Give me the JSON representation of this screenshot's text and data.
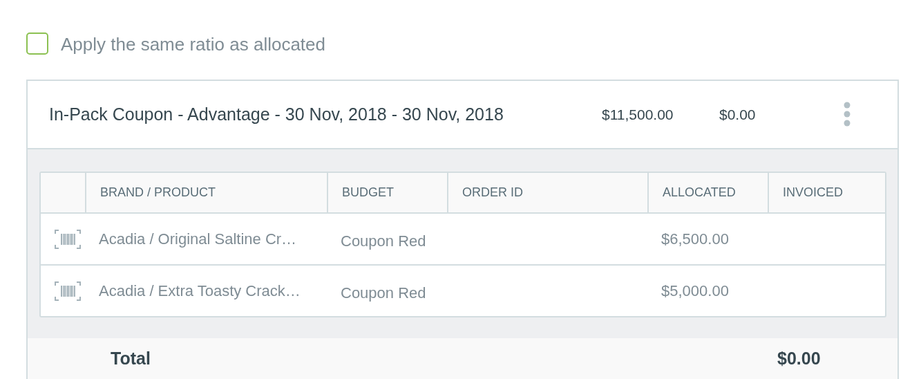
{
  "apply_ratio": {
    "label": "Apply the same ratio as allocated",
    "checked": false
  },
  "line": {
    "title": "In-Pack Coupon - Advantage - 30 Nov, 2018 - 30 Nov, 2018",
    "amount": "$11,500.00",
    "invoiced": "$0.00"
  },
  "table": {
    "columns": [
      "BRAND / PRODUCT",
      "BUDGET",
      "ORDER ID",
      "ALLOCATED",
      "INVOICED"
    ],
    "rows": [
      {
        "product": "Acadia / Original Saltine Cr…",
        "budget": "Coupon Red",
        "allocated": "$6,500.00"
      },
      {
        "product": "Acadia / Extra Toasty Crack…",
        "budget": "Coupon Red",
        "allocated": "$5,000.00"
      }
    ]
  },
  "total": {
    "label": "Total",
    "value": "$0.00"
  }
}
